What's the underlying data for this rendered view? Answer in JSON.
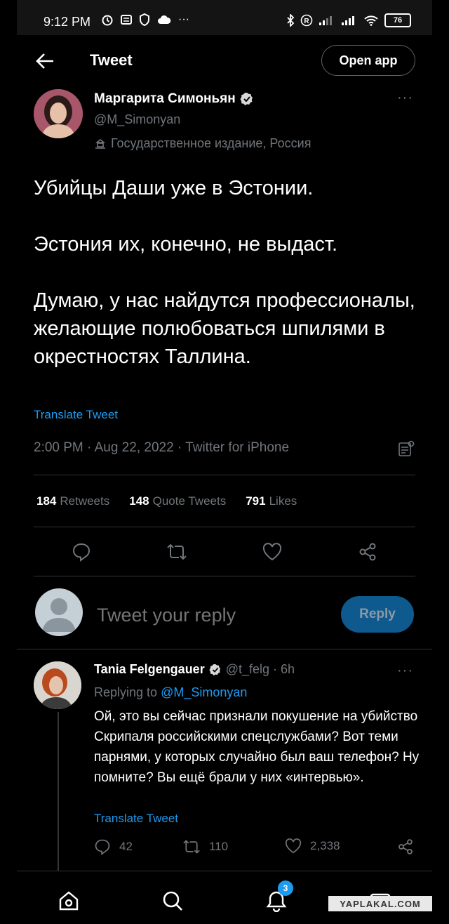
{
  "status_bar": {
    "time": "9:12 PM",
    "battery": "76"
  },
  "header": {
    "title": "Tweet",
    "open_app_label": "Open app"
  },
  "tweet": {
    "author_name": "Маргарита Симоньян",
    "author_handle": "@M_Simonyan",
    "author_label": "Государственное издание, Россия",
    "paragraphs": [
      "Убийцы Даши уже в Эстонии.",
      "Эстония их, конечно, не выдаст.",
      "Думаю, у нас найдутся профессионалы, желающие полюбоваться шпилями в окрестностях Таллина."
    ],
    "translate_label": "Translate Tweet",
    "meta": "2:00 PM · Aug 22, 2022 · Twitter for iPhone",
    "stats": {
      "retweets_count": "184",
      "retweets_label": "Retweets",
      "quotes_count": "148",
      "quotes_label": "Quote Tweets",
      "likes_count": "791",
      "likes_label": "Likes"
    }
  },
  "compose": {
    "placeholder": "Tweet your reply",
    "reply_label": "Reply"
  },
  "reply": {
    "author_name": "Tania Felgengauer",
    "author_handle_time": "@t_felg · 6h",
    "replying_prefix": "Replying to",
    "replying_to": "@M_Simonyan",
    "text": "Ой, это вы сейчас признали покушение на убийство Скрипаля российскими спецслужбами? Вот теми парнями, у которых случайно был ваш телефон? Ну помните? Вы ещё брали у них «интервью».",
    "translate_label": "Translate Tweet",
    "replies": "42",
    "retweets": "110",
    "likes": "2,338"
  },
  "nav": {
    "notifications_badge": "3"
  },
  "watermark": "YAPLAKAL.COM",
  "colors": {
    "accent": "#1d9bf0",
    "background": "#000000",
    "muted": "#71767b"
  }
}
